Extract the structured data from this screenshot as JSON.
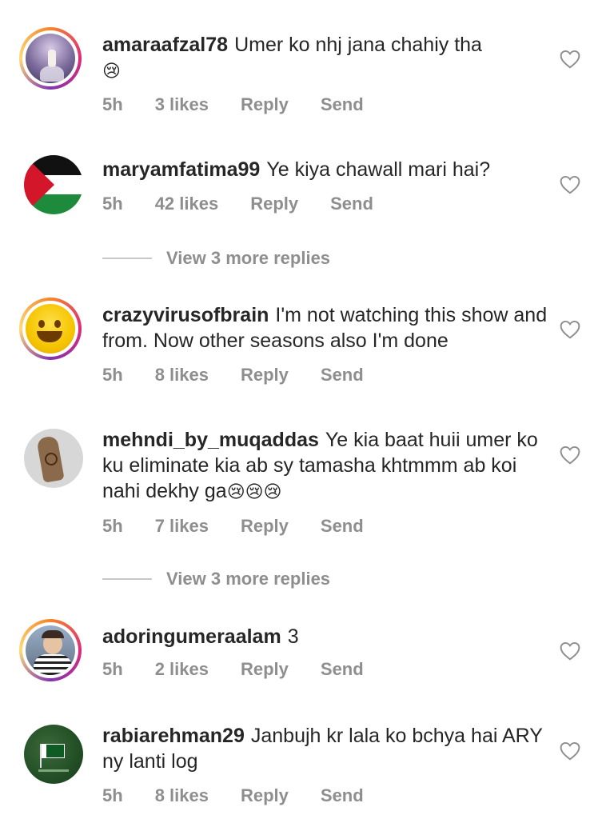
{
  "comments": [
    {
      "username": "amaraafzal78",
      "text": "Umer ko nhj jana chahiy tha",
      "emoji": "😢",
      "time": "5h",
      "likes": "3 likes",
      "reply": "Reply",
      "send": "Send"
    },
    {
      "username": "maryamfatima99",
      "text": "Ye kiya chawall mari hai?",
      "emoji": "",
      "time": "5h",
      "likes": "42 likes",
      "reply": "Reply",
      "send": "Send"
    },
    {
      "username": "crazyvirusofbrain",
      "text": "I'm not watching this show and from. Now other seasons also I'm done",
      "emoji": "",
      "time": "5h",
      "likes": "8 likes",
      "reply": "Reply",
      "send": "Send"
    },
    {
      "username": "mehndi_by_muqaddas",
      "text": "Ye kia baat huii umer ko ku eliminate kia ab sy tamasha khtmmm ab koi nahi dekhy ga",
      "emoji": "😢😢😢",
      "time": "5h",
      "likes": "7 likes",
      "reply": "Reply",
      "send": "Send"
    },
    {
      "username": "adoringumeraalam",
      "text": "3",
      "emoji": "",
      "time": "5h",
      "likes": "2 likes",
      "reply": "Reply",
      "send": "Send"
    },
    {
      "username": "rabiarehman29",
      "text": "Janbujh kr lala ko bchya hai ARY ny lanti log",
      "emoji": "",
      "time": "5h",
      "likes": "8 likes",
      "reply": "Reply",
      "send": "Send"
    }
  ],
  "view_more": [
    "View 3 more replies",
    "View 3 more replies"
  ],
  "colors": {
    "text": "#262626",
    "meta": "#8e8e8e",
    "divider": "#c7c7c7"
  }
}
